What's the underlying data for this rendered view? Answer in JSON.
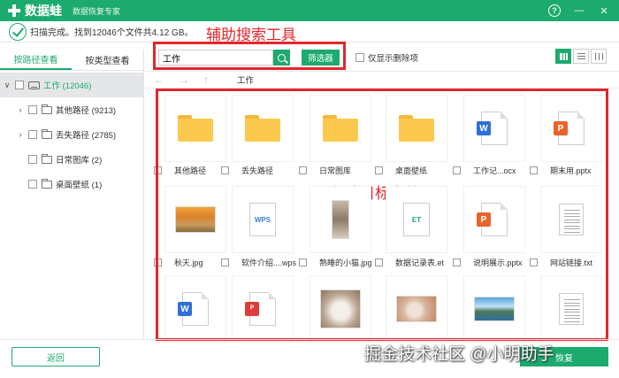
{
  "app": {
    "name": "数据蛙",
    "subtitle": "数据恢复专家",
    "help_glyph": "?",
    "minimize_glyph": "—",
    "close_glyph": "✕"
  },
  "status": {
    "text": "扫描完成。找到12046个文件共4.12 GB。"
  },
  "annotations": {
    "search_tool": "辅助搜索工具",
    "select_files": "勾选目标文件",
    "color": "#e3262a"
  },
  "sidebar": {
    "tabs": [
      {
        "label": "按路径查看",
        "active": true
      },
      {
        "label": "按类型查看",
        "active": false
      }
    ],
    "root": {
      "label": "工作 (12046)"
    },
    "items": [
      {
        "label": "其他路径 (9213)",
        "expandable": true
      },
      {
        "label": "丢失路径 (2785)",
        "expandable": true
      },
      {
        "label": "日常图库 (2)",
        "expandable": false
      },
      {
        "label": "桌面壁纸 (1)",
        "expandable": false
      }
    ]
  },
  "toolbar": {
    "search_value": "工作",
    "filter_label": "筛选器",
    "deleted_only_label": "仅显示删除项",
    "view_modes": [
      "grid",
      "list",
      "detail"
    ],
    "active_view": "grid"
  },
  "nav": {
    "breadcrumb": "工作"
  },
  "files": [
    {
      "name": "其他路径",
      "type": "folder"
    },
    {
      "name": "丢失路径",
      "type": "folder"
    },
    {
      "name": "日常图库",
      "type": "folder"
    },
    {
      "name": "桌面壁纸",
      "type": "folder"
    },
    {
      "name": "工作记...ocx",
      "type": "word"
    },
    {
      "name": "期末用.pptx",
      "type": "ppt"
    },
    {
      "name": "秋天.jpg",
      "type": "photo-autumn"
    },
    {
      "name": "软件介绍....wps",
      "type": "wps"
    },
    {
      "name": "熟睡的小猫.jpg",
      "type": "photo-cat"
    },
    {
      "name": "数据记录表.et",
      "type": "et"
    },
    {
      "name": "说明展示.pptx",
      "type": "ppt"
    },
    {
      "name": "网站链接.txt",
      "type": "txt"
    },
    {
      "name": "",
      "type": "word"
    },
    {
      "name": "",
      "type": "wps-red"
    },
    {
      "name": "",
      "type": "photo-kitten"
    },
    {
      "name": "",
      "type": "photo-rabbit"
    },
    {
      "name": "",
      "type": "photo-lake"
    },
    {
      "name": "",
      "type": "txt"
    }
  ],
  "footer": {
    "back_label": "返回",
    "recover_label": "恢复",
    "watermark": "掘金技术社区 @小明助手"
  },
  "colors": {
    "accent": "#1daa6e",
    "word": "#2f6fd6",
    "ppt": "#e8632b",
    "wps_red": "#e03a3a",
    "folder": "#fbc94d"
  },
  "icons": {
    "word_badge": "W",
    "ppt_badge": "P",
    "wps_text": "WPS",
    "et_text": "ET",
    "wps_red_badge": "ᴾ"
  }
}
